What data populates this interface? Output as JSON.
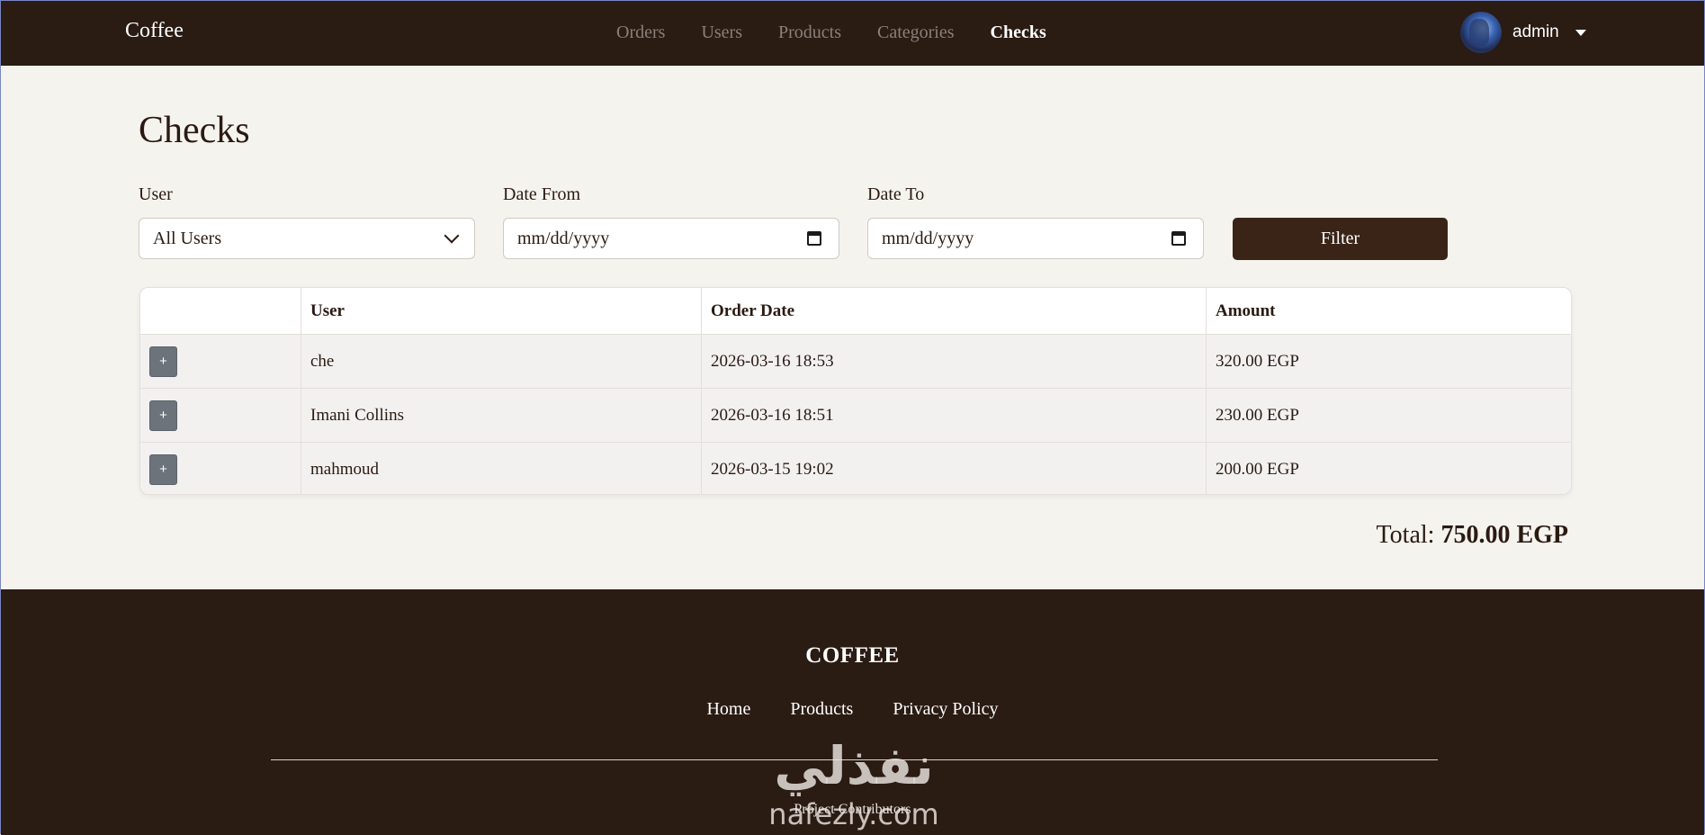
{
  "navbar": {
    "brand": "Coffee",
    "links": [
      "Orders",
      "Users",
      "Products",
      "Categories",
      "Checks"
    ],
    "active_link": "Checks",
    "username": "admin"
  },
  "page": {
    "title": "Checks"
  },
  "filters": {
    "user_label": "User",
    "user_value": "All Users",
    "date_from_label": "Date From",
    "date_from_placeholder": "mm/dd/yyyy",
    "date_to_label": "Date To",
    "date_to_placeholder": "mm/dd/yyyy",
    "filter_button": "Filter"
  },
  "table": {
    "headers": [
      "",
      "User",
      "Order Date",
      "Amount"
    ],
    "rows": [
      {
        "expand": "+",
        "user": "che",
        "date": "2026-03-16 18:53",
        "amount": "320.00 EGP"
      },
      {
        "expand": "+",
        "user": "Imani Collins",
        "date": "2026-03-16 18:51",
        "amount": "230.00 EGP"
      },
      {
        "expand": "+",
        "user": "mahmoud",
        "date": "2026-03-15 19:02",
        "amount": "200.00 EGP"
      }
    ]
  },
  "total": {
    "label": "Total:",
    "value": "750.00 EGP"
  },
  "footer": {
    "brand": "COFFEE",
    "links": [
      "Home",
      "Products",
      "Privacy Policy"
    ],
    "contributors": "Project Contributors"
  },
  "watermark": {
    "arabic": "نفذلي",
    "latin": "nafezly.com"
  },
  "colors": {
    "navbar_bg": "#2a1b13",
    "page_bg": "#f5f3ee",
    "button_brown": "#3a2418",
    "expand_gray": "#6c737a"
  }
}
